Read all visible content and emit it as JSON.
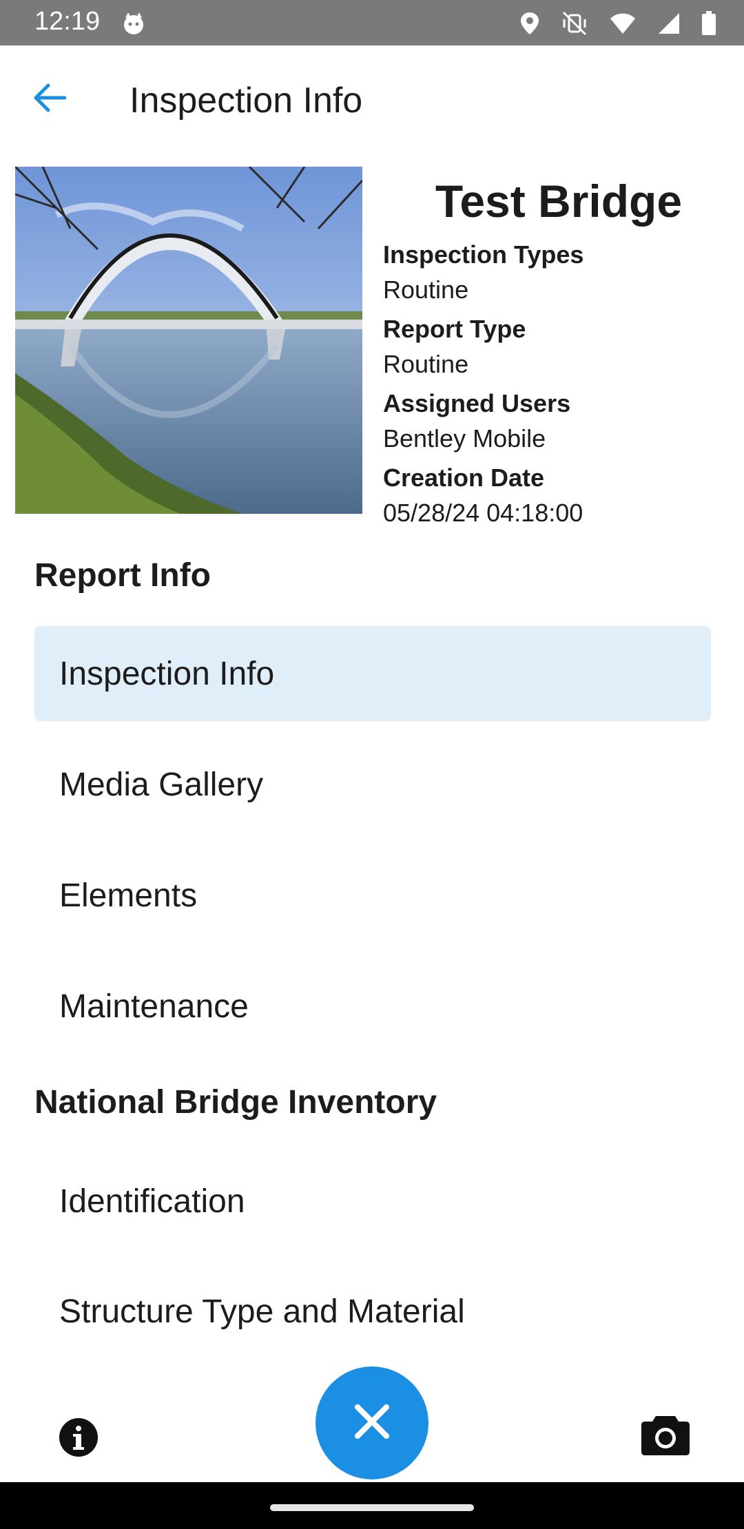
{
  "status_bar": {
    "time": "12:19",
    "icons": [
      "cat-app-icon",
      "location-icon",
      "vibrate-off-icon",
      "wifi-icon",
      "signal-icon",
      "battery-icon"
    ]
  },
  "app_bar": {
    "title": "Inspection Info",
    "back_icon": "arrow-back-icon",
    "accent_color": "#1a8fe3"
  },
  "asset": {
    "name": "Test Bridge",
    "photo": "bridge-photo",
    "details": [
      {
        "label": "Inspection Types",
        "value": "Routine"
      },
      {
        "label": "Report Type",
        "value": "Routine"
      },
      {
        "label": "Assigned Users",
        "value": "Bentley Mobile"
      },
      {
        "label": "Creation Date",
        "value": "05/28/24 04:18:00"
      }
    ]
  },
  "sections": [
    {
      "title": "Report Info",
      "items": [
        {
          "label": "Inspection Info",
          "selected": true
        },
        {
          "label": "Media Gallery",
          "selected": false
        },
        {
          "label": "Elements",
          "selected": false
        },
        {
          "label": "Maintenance",
          "selected": false
        }
      ]
    },
    {
      "title": "National Bridge Inventory",
      "items": [
        {
          "label": "Identification",
          "selected": false
        },
        {
          "label": "Structure Type and Material",
          "selected": false
        }
      ]
    }
  ],
  "bottom_bar": {
    "left_icon": "info-icon",
    "center_icon": "close-icon",
    "right_icon": "camera-icon",
    "fab_color": "#1a8fe3"
  }
}
